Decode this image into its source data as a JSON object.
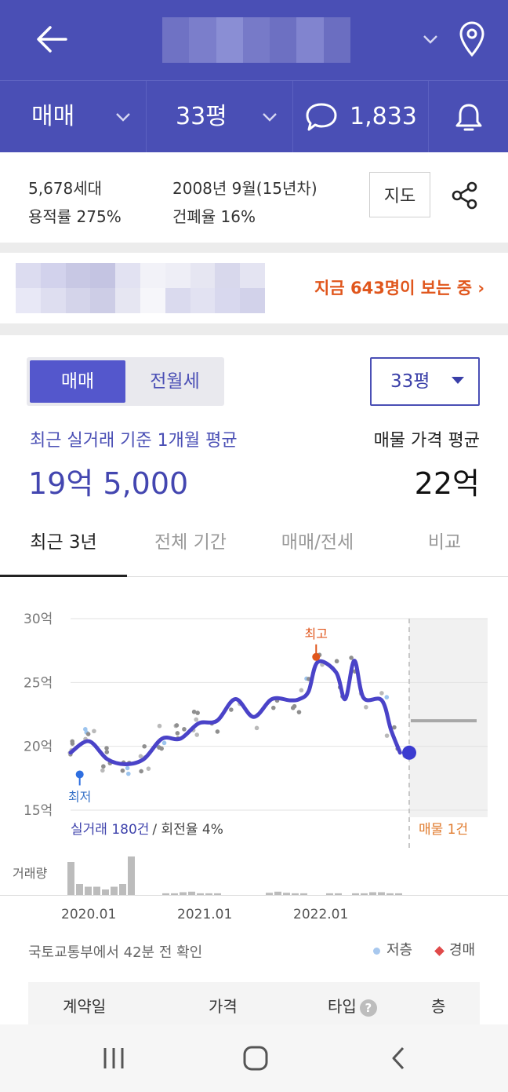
{
  "header": {
    "back_icon": "arrow-left-icon",
    "location_icon": "map-pin-icon",
    "title_blur_colors": [
      "#6f72c4",
      "#7b7ecb",
      "#8a8ed4",
      "#777ac8",
      "#6d70c2",
      "#8184cf",
      "#6b6ec1"
    ]
  },
  "subbar": {
    "trade_type": "매매",
    "size": "33평",
    "comment_count": "1,833",
    "comment_icon": "chat-bubble-icon",
    "alarm_icon": "bell-icon"
  },
  "info": {
    "households": "5,678세대",
    "floor_area_ratio": "용적률 275%",
    "built": "2008년 9월(15년차)",
    "building_coverage": "건폐율 16%",
    "map_button": "지도",
    "share_icon": "share-icon"
  },
  "viewers": {
    "text": "지금 643명이 보는 중 ›",
    "ad_blur_colors": [
      "#dcdcf0",
      "#d2d2ec",
      "#c8c8e4",
      "#c4c4e2",
      "#e2e2f2",
      "#f2f2f8",
      "#eeeef6",
      "#e6e6f2",
      "#d8d8ec",
      "#e4e4f2",
      "#e8e8f6",
      "#dedef0",
      "#d4d4ea",
      "#cdcde6",
      "#e6e6f2",
      "#f6f6fa",
      "#dadaee",
      "#e2e2f2",
      "#d8d8ee",
      "#d2d2ea"
    ]
  },
  "main": {
    "toggle_on": "매매",
    "toggle_off": "전월세",
    "size_select": "33평",
    "avg_label": "최근 실거래 기준 1개월 평균",
    "avg_value": "19억 5,000",
    "ask_label": "매물 가격 평균",
    "ask_value": "22억"
  },
  "tabs": [
    "최근 3년",
    "전체 기간",
    "매매/전세",
    "비교"
  ],
  "chart_data": {
    "type": "line",
    "y_ticks": [
      "30억",
      "25억",
      "20억",
      "15억"
    ],
    "ylim": [
      15,
      30
    ],
    "x_ticks": [
      "2020.01",
      "2021.01",
      "2022.01"
    ],
    "series": [
      {
        "values_label": "실거래 평균",
        "x": [
          "2019.10",
          "2019.12",
          "2020.02",
          "2020.04",
          "2020.06",
          "2020.08",
          "2020.10",
          "2020.12",
          "2021.02",
          "2021.04",
          "2021.06",
          "2021.08",
          "2021.10",
          "2021.11",
          "2021.12",
          "2022.01",
          "2022.03",
          "2022.04",
          "2022.05",
          "2022.06",
          "2022.08",
          "2022.09",
          "2022.10"
        ],
        "values": [
          19.5,
          20.4,
          19.0,
          18.6,
          19.0,
          20.6,
          20.6,
          21.8,
          22.0,
          23.7,
          22.3,
          23.7,
          23.6,
          23.7,
          24.3,
          26.6,
          25.8,
          23.7,
          26.7,
          23.8,
          23.6,
          21.3,
          19.5
        ]
      }
    ],
    "annotations": {
      "high": "최고",
      "low": "최저",
      "trade_summary": "실거래 180건",
      "turnover": "/ 회전율 4%",
      "listing": "매물 1건",
      "volume_label": "거래량"
    },
    "high_value": 27.0,
    "low_value": 17.8,
    "listing_price": 22.0,
    "volume": [
      6,
      2,
      1.5,
      1.5,
      1,
      1.5,
      2,
      7,
      0,
      0,
      0,
      0.3,
      0.3,
      0.5,
      0.6,
      0.3,
      0.3,
      0.3,
      0,
      0,
      0,
      0,
      0,
      0.4,
      0.6,
      0.4,
      0.3,
      0.3,
      0,
      0,
      0.3,
      0.3,
      0,
      0.3,
      0.3,
      0.5,
      0.5,
      0.3,
      0.3
    ]
  },
  "footer": {
    "source": "국토교통부에서 42분 전 확인",
    "legend_low": "저층",
    "legend_auction": "경매",
    "table_headers": [
      "계약일",
      "가격",
      "타입",
      "층"
    ],
    "help_icon": "question-circle-icon"
  },
  "navbar": {
    "recents_icon": "recent-apps-icon",
    "home_icon": "home-icon",
    "back_icon": "nav-back-icon"
  },
  "colors": {
    "brand": "#4a4fb5",
    "accent_orange": "#e0561c",
    "chart_line": "#4a43c8"
  }
}
